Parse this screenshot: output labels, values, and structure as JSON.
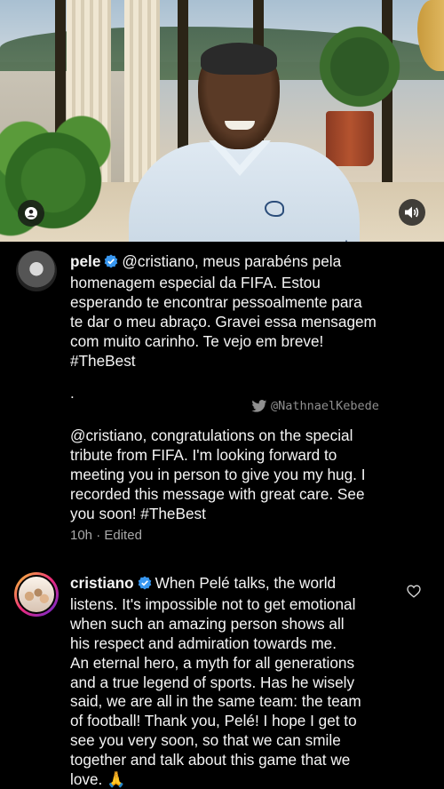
{
  "video": {
    "shirt_text": "pele"
  },
  "comments": [
    {
      "username": "pele",
      "lines": [
        "@cristiano, meus parabéns pela",
        "homenagem especial da FIFA. Estou",
        "esperando te encontrar pessoalmente para",
        "te dar o meu abraço. Gravei essa mensagem",
        "com muito carinho. Te vejo em breve!",
        "#TheBest"
      ],
      "separator": ".",
      "translation_lines": [
        "@cristiano, congratulations on the special",
        "tribute from FIFA. I'm looking forward to",
        "meeting you in person to give you my hug. I",
        "recorded this message with great care. See",
        "you soon! #TheBest"
      ],
      "time": "10h",
      "dot": "·",
      "edited": "Edited"
    },
    {
      "username": "cristiano",
      "lines": [
        "When Pelé talks, the world",
        "listens. It's impossible not to get emotional",
        "when such an amazing person shows all",
        "his respect and admiration towards me.",
        "An eternal hero, a myth for all generations",
        "and a true legend of sports. Has he wisely",
        "said, we are all in the same team: the team",
        "of football! Thank you, Pelé! I hope I get to",
        "see you very soon, so that we can smile",
        "together and talk about this game that we",
        "love. 🙏"
      ]
    }
  ],
  "watermark": "@NathnaelKebede",
  "icons": {
    "profile": "person-icon",
    "sound": "speaker-icon",
    "verified": "verified-badge-icon",
    "like": "heart-icon",
    "twitter": "twitter-bird-icon"
  },
  "colors": {
    "background": "#000000",
    "text": "#f5f5f5",
    "meta": "#a8a8a8",
    "verified": "#3897f0"
  }
}
